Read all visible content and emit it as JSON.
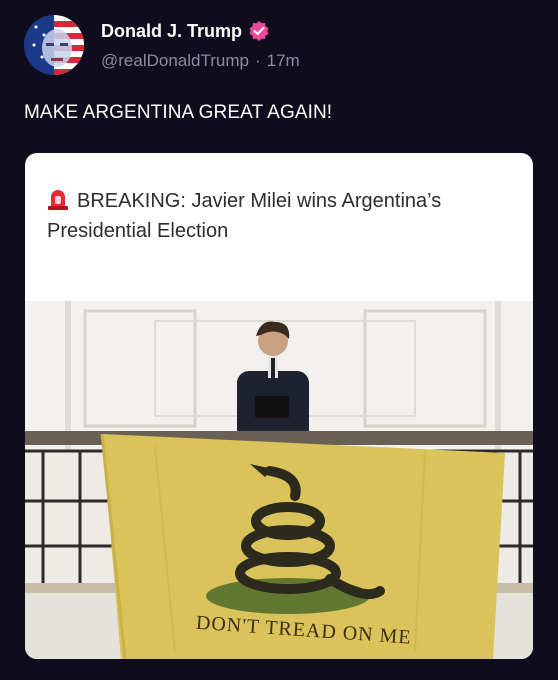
{
  "post": {
    "author": {
      "display_name": "Donald J. Trump",
      "handle": "@realDonaldTrump",
      "separator": "·",
      "timestamp": "17m",
      "verified_color": "#ec4899"
    },
    "text": "MAKE ARGENTINA GREAT AGAIN!"
  },
  "card": {
    "siren_icon": "police-siren-icon",
    "headline": "BREAKING: Javier Milei wins Argentina’s Presidential Election",
    "image": {
      "flag_motto": "DON'T TREAD ON ME",
      "flag_color": "#d9c35a"
    }
  },
  "colors": {
    "background": "#0f0d1d",
    "secondary_text": "#8b8aa0",
    "card_background": "#ffffff"
  }
}
